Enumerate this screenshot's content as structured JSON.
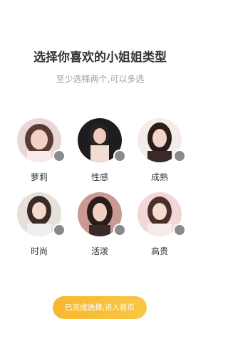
{
  "header": {
    "title": "选择你喜欢的小姐姐类型",
    "subtitle": "至少选择两个,可以多选"
  },
  "types": [
    {
      "label": "萝莉",
      "selected": false
    },
    {
      "label": "性感",
      "selected": false
    },
    {
      "label": "成熟",
      "selected": false
    },
    {
      "label": "时尚",
      "selected": false
    },
    {
      "label": "活泼",
      "selected": false
    },
    {
      "label": "高贵",
      "selected": false
    }
  ],
  "footer": {
    "button_label": "已完成选择,进入首页"
  },
  "colors": {
    "accent": "#f8bd38",
    "check_inactive": "#8a8a8a"
  }
}
